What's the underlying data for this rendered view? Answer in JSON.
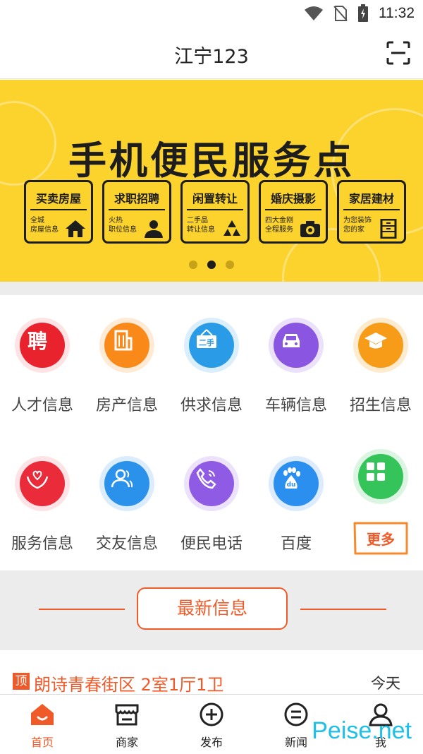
{
  "status_bar": {
    "time": "11:32",
    "icons": [
      "wifi-icon",
      "no-sim-icon",
      "battery-charging-icon"
    ]
  },
  "header": {
    "title": "江宁123",
    "scan_icon": "scan-icon"
  },
  "banner": {
    "title": "手机便民服务点",
    "cards": [
      {
        "title": "买卖房屋",
        "sub": "全城\n房屋信息",
        "icon": "house-icon"
      },
      {
        "title": "求职招聘",
        "sub": "火热\n职位信息",
        "icon": "person-icon"
      },
      {
        "title": "闲置转让",
        "sub": "二手品\n转让信息",
        "icon": "recycle-icon"
      },
      {
        "title": "婚庆摄影",
        "sub": "四大金刚\n全程服务",
        "icon": "camera-icon"
      },
      {
        "title": "家居建材",
        "sub": "为您装饰\n您的家",
        "icon": "cabinet-icon"
      }
    ],
    "pages": 3,
    "active_page": 2,
    "color": "#fcd22c"
  },
  "grid": {
    "items": [
      {
        "label": "人才信息",
        "icon": "recruit-icon",
        "color": "#e8232e"
      },
      {
        "label": "房产信息",
        "icon": "building-icon",
        "color": "#f98a1a"
      },
      {
        "label": "供求信息",
        "icon": "secondhand-sign-icon",
        "color": "#2a9be6"
      },
      {
        "label": "车辆信息",
        "icon": "car-icon",
        "color": "#8a55e0"
      },
      {
        "label": "招生信息",
        "icon": "graduation-cap-icon",
        "color": "#f69c19"
      },
      {
        "label": "服务信息",
        "icon": "heart-hands-icon",
        "color": "#ea2b3a"
      },
      {
        "label": "交友信息",
        "icon": "people-icon",
        "color": "#2a92ea"
      },
      {
        "label": "便民电话",
        "icon": "phone-icon",
        "color": "#8f5ae4"
      },
      {
        "label": "百度",
        "icon": "baidu-paw-icon",
        "color": "#2b8ff0"
      },
      {
        "label": "",
        "icon": "apps-grid-icon",
        "color": "#35c45a"
      }
    ],
    "more_label": "更多"
  },
  "news_section": {
    "title": "最新信息",
    "accent": "#f05a28"
  },
  "list": [
    {
      "badge": "顶",
      "title": "朗诗青春街区 2室1厅1卫",
      "time": "今天"
    }
  ],
  "tabbar": {
    "tabs": [
      {
        "label": "首页",
        "icon": "home-icon",
        "active": true
      },
      {
        "label": "商家",
        "icon": "shop-icon",
        "active": false
      },
      {
        "label": "发布",
        "icon": "plus-circle-icon",
        "active": false
      },
      {
        "label": "新闻",
        "icon": "news-icon",
        "active": false
      },
      {
        "label": "我",
        "icon": "user-icon",
        "active": false
      }
    ]
  },
  "watermark": "Peise.net"
}
